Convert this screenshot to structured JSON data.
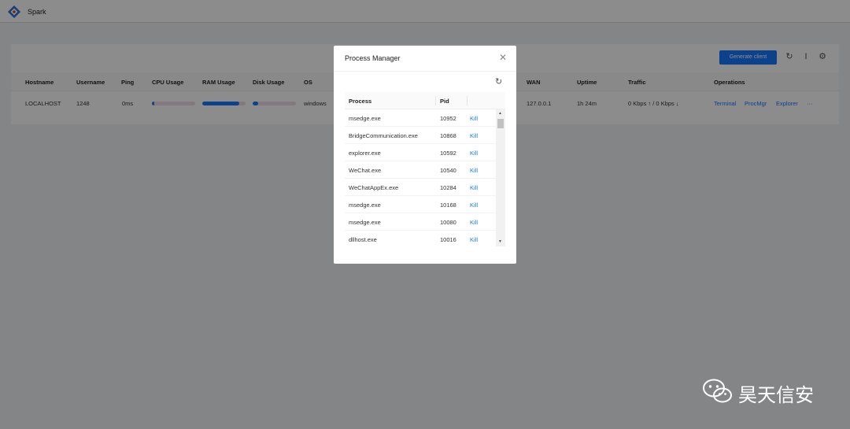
{
  "app": {
    "title": "Spark"
  },
  "toolbar": {
    "generate_label": "Generate client",
    "icons": [
      "refresh-icon",
      "text-cursor-icon",
      "gear-icon"
    ]
  },
  "table": {
    "columns": [
      "Hostname",
      "Username",
      "Ping",
      "CPU Usage",
      "RAM Usage",
      "Disk Usage",
      "OS",
      "WAN",
      "Uptime",
      "Traffic",
      "Operations"
    ],
    "row": {
      "hostname": "LOCALHOST",
      "username": "1248",
      "ping": "0ms",
      "cpu_usage": 0.05,
      "ram_usage": 0.85,
      "disk_usage": 0.12,
      "os": "windows",
      "wan": "127.0.0.1",
      "uptime": "1h 24m",
      "traffic": "0 Kbps ↑ / 0 Kbps ↓",
      "operations": [
        "Terminal",
        "ProcMgr",
        "Explorer",
        "···"
      ]
    }
  },
  "modal": {
    "title": "Process Manager",
    "columns": [
      "Process",
      "Pid"
    ],
    "kill_label": "Kill",
    "processes": [
      {
        "name": "msedge.exe",
        "pid": "10952"
      },
      {
        "name": "BridgeCommunication.exe",
        "pid": "10868"
      },
      {
        "name": "explorer.exe",
        "pid": "10592"
      },
      {
        "name": "WeChat.exe",
        "pid": "10540"
      },
      {
        "name": "WeChatAppEx.exe",
        "pid": "10284"
      },
      {
        "name": "msedge.exe",
        "pid": "10168"
      },
      {
        "name": "msedge.exe",
        "pid": "10080"
      },
      {
        "name": "dllhost.exe",
        "pid": "10016"
      }
    ]
  },
  "watermark": {
    "text": "昊天信安"
  },
  "colors": {
    "accent": "#1677ff",
    "bar_track": "#eedde7"
  }
}
